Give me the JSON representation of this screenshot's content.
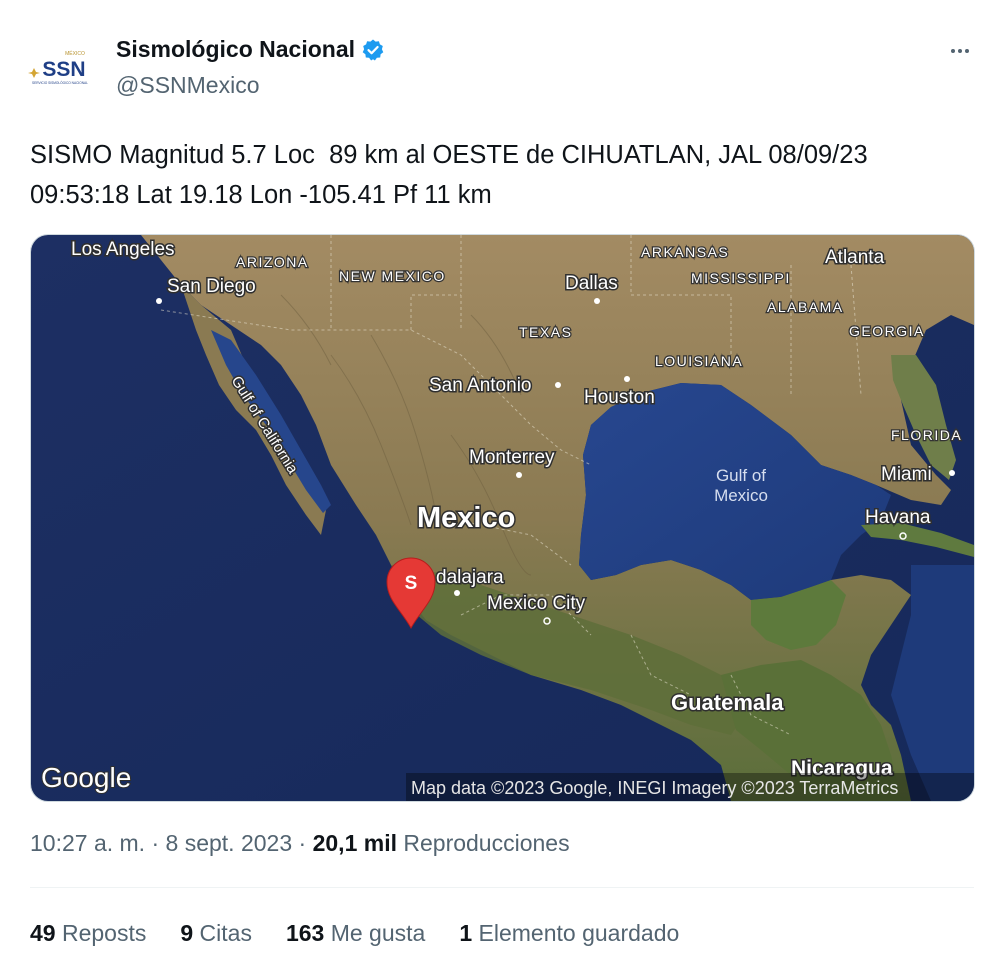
{
  "account": {
    "name": "Sismológico Nacional",
    "handle": "@SSNMexico",
    "avatar_text": "SSN",
    "avatar_top_text": "MÉXICO",
    "avatar_sub_text": "SERVICIO SISMOLÓGICO NACIONAL",
    "verified_color": "#1d9bf0"
  },
  "tweet": {
    "text": "SISMO Magnitud 5.7 Loc  89 km al OESTE de CIHUATLAN, JAL 08/09/23\n09:53:18 Lat 19.18 Lon -105.41 Pf 11 km"
  },
  "map": {
    "labels": {
      "los_angeles": "Los Angeles",
      "san_diego": "San Diego",
      "arizona": "ARIZONA",
      "new_mexico": "NEW MEXICO",
      "arkansas": "ARKANSAS",
      "mississippi": "MISSISSIPPI",
      "atlanta": "Atlanta",
      "dallas": "Dallas",
      "alabama": "ALABAMA",
      "georgia": "GEORGIA",
      "texas": "TEXAS",
      "louisiana": "LOUISIANA",
      "san_antonio": "San Antonio",
      "houston": "Houston",
      "gulf_of_california": "Gulf of California",
      "florida": "FLORIDA",
      "gulf_of_mexico_1": "Gulf of",
      "gulf_of_mexico_2": "Mexico",
      "miami": "Miami",
      "monterrey": "Monterrey",
      "mexico": "Mexico",
      "havana": "Havana",
      "guadalajara": "dalajara",
      "mexico_city": "Mexico City",
      "guatemala": "Guatemala",
      "nicaragua": "Nicaragua"
    },
    "marker_letter": "S",
    "marker_color": "#e53935",
    "google_logo": "Google",
    "attribution": "Map data ©2023 Google, INEGI Imagery ©2023 TerraMetrics"
  },
  "meta": {
    "time": "10:27 a. m.",
    "sep1": " · ",
    "date": "8 sept. 2023",
    "sep2": " · ",
    "views_count": "20,1 mil",
    "views_label": " Reproducciones"
  },
  "stats": [
    {
      "count": "49",
      "label": " Reposts"
    },
    {
      "count": "9",
      "label": " Citas"
    },
    {
      "count": "163",
      "label": " Me gusta"
    },
    {
      "count": "1",
      "label": " Elemento guardado"
    }
  ]
}
